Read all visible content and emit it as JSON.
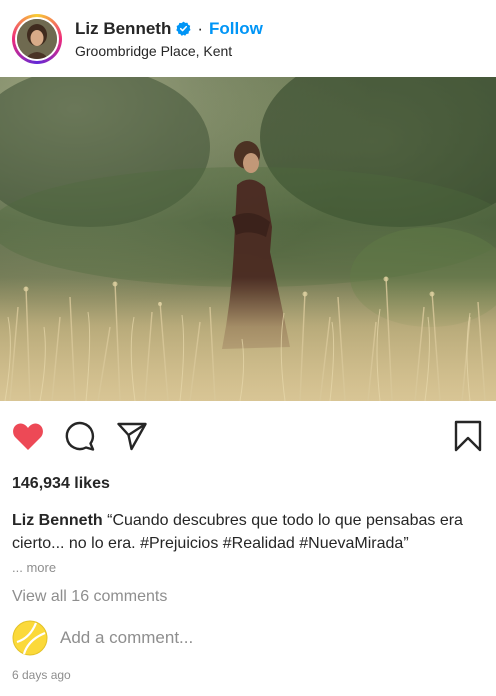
{
  "header": {
    "username": "Liz Benneth",
    "separator": "·",
    "follow_label": "Follow",
    "location": "Groombridge Place, Kent",
    "verified_icon": "verified-badge-icon"
  },
  "post": {
    "image_alt": "Woman in a long dress standing in a sunlit meadow of tall grass",
    "liked": true,
    "like_color": "#ed4956",
    "likes_text": "146,934 likes",
    "caption_user": "Liz Benneth",
    "caption_text": "“Cuando descubres que todo lo que pensabas era cierto... no lo era. #Prejuicios #Realidad #NuevaMirada”",
    "more_label": "... more",
    "view_comments_label": "View all 16 comments",
    "add_comment_placeholder": "Add a comment...",
    "time_ago": "6 days ago"
  },
  "icons": {
    "like": "heart-icon",
    "comment": "comment-icon",
    "share": "send-icon",
    "save": "bookmark-icon"
  },
  "colors": {
    "accent": "#0095f6",
    "muted": "#8e8e8e",
    "text": "#262626"
  }
}
